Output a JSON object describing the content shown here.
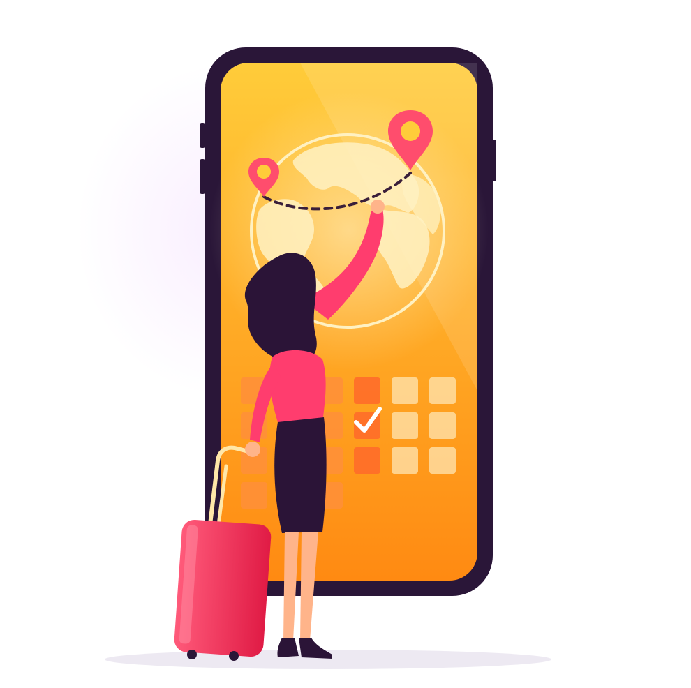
{
  "colors": {
    "background": "#ffffff",
    "phone_frame": "#2a1638",
    "screen_top": "#ffcc3a",
    "screen_bottom": "#ff8a12",
    "globe": "#fff1c2",
    "pin": "#ff4d6d",
    "route": "#3a1f3a",
    "calendar_cell_dark": "#ff6a2a",
    "calendar_cell_mid": "#ff8f3a",
    "calendar_cell_light": "#ffe6b3",
    "checkmark": "#ffffff",
    "top": "#ff3d6e",
    "skirt": "#2b1437",
    "hair": "#2b1437",
    "skin": "#ffb48a",
    "suitcase": "#ff2d55",
    "suitcase_handle": "#ffe7a8"
  },
  "icons": [
    "smartphone-icon",
    "globe-icon",
    "location-pin-icon",
    "location-pin-icon",
    "dashed-route-icon",
    "calendar-grid-icon",
    "checkmark-icon",
    "suitcase-icon",
    "woman-traveler-figure"
  ],
  "calendar": {
    "rows": 4,
    "columns": 6,
    "checked_cell": {
      "row": 2,
      "column": 4
    }
  }
}
